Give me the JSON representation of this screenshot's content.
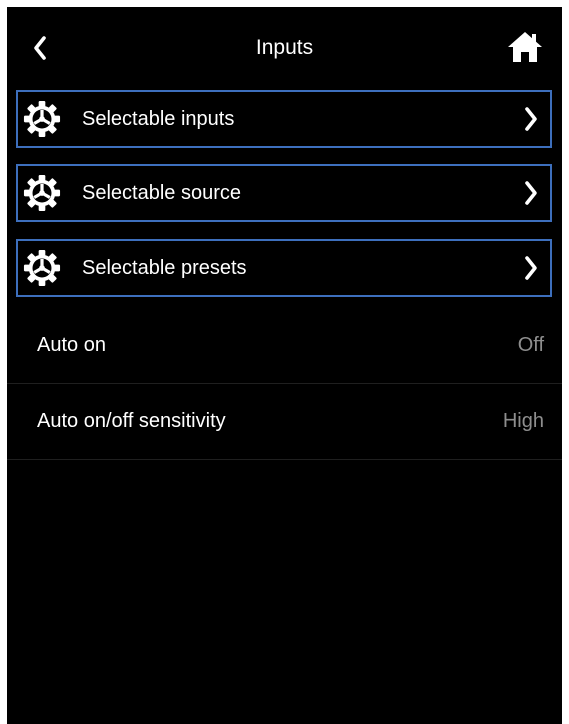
{
  "header": {
    "title": "Inputs",
    "back_icon": "chevron-left-icon",
    "home_icon": "home-icon"
  },
  "nav_items": [
    {
      "label": "Selectable inputs",
      "icon": "gear-icon"
    },
    {
      "label": "Selectable source",
      "icon": "gear-icon"
    },
    {
      "label": "Selectable presets",
      "icon": "gear-icon"
    }
  ],
  "settings": [
    {
      "label": "Auto on",
      "value": "Off"
    },
    {
      "label": "Auto on/off sensitivity",
      "value": "High"
    }
  ],
  "colors": {
    "background": "#000000",
    "text": "#ffffff",
    "secondary_text": "#8e8e8e",
    "focus_border": "#3d6fbd"
  }
}
